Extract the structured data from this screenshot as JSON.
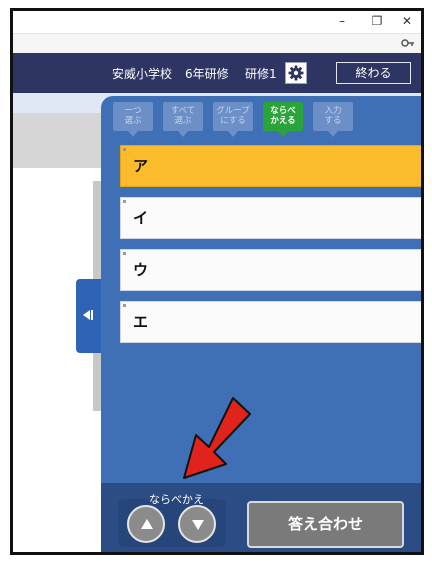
{
  "window": {
    "minimize_label": "–",
    "restore_label": "❐",
    "close_label": "✕"
  },
  "header": {
    "school": "安威小学校",
    "grade": "6年研修",
    "session": "研修1",
    "end_label": "終わる"
  },
  "mode_tabs": [
    {
      "label_line1": "一つ",
      "label_line2": "選ぶ"
    },
    {
      "label_line1": "すべて",
      "label_line2": "選ぶ"
    },
    {
      "label_line1": "グループ",
      "label_line2": "にする"
    },
    {
      "label_line1": "ならべ",
      "label_line2": "かえる"
    },
    {
      "label_line1": "入力",
      "label_line2": "する"
    }
  ],
  "active_mode_index": 3,
  "items": [
    {
      "label": "ア",
      "selected": true
    },
    {
      "label": "イ",
      "selected": false
    },
    {
      "label": "ウ",
      "selected": false
    },
    {
      "label": "エ",
      "selected": false
    }
  ],
  "reorder": {
    "label": "ならべかえ"
  },
  "check_button_label": "答え合わせ",
  "colors": {
    "header_bg": "#2e3563",
    "panel_bg": "#3f6fb4",
    "active_tab": "#2aa33a",
    "selected_item": "#fbbc2b",
    "annotation_arrow": "#e0241b"
  }
}
